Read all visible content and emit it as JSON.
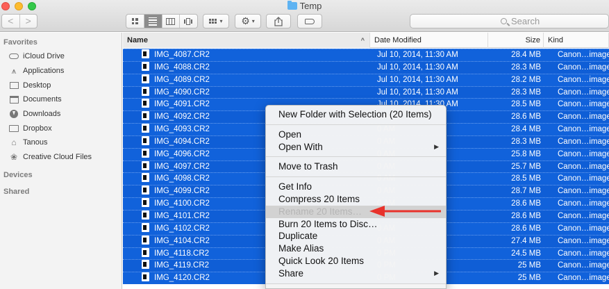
{
  "window": {
    "title": "Temp"
  },
  "toolbar": {
    "back_glyph": "<",
    "forward_glyph": ">",
    "view_modes": [
      "icon-view",
      "list-view",
      "column-view",
      "cover-flow-view"
    ],
    "active_view": "list-view",
    "arrange_icon": "arrange-icon",
    "action_icon": "gear-icon",
    "share_icon": "share-icon",
    "tag_icon": "tag-icon",
    "search_placeholder": "Search"
  },
  "sidebar": {
    "favorites_label": "Favorites",
    "items": [
      {
        "label": "iCloud Drive",
        "icon": "cloud-icon"
      },
      {
        "label": "Applications",
        "icon": "applications-icon"
      },
      {
        "label": "Desktop",
        "icon": "desktop-icon"
      },
      {
        "label": "Documents",
        "icon": "documents-icon"
      },
      {
        "label": "Downloads",
        "icon": "downloads-icon"
      },
      {
        "label": "Dropbox",
        "icon": "folder-icon"
      },
      {
        "label": "Tanous",
        "icon": "home-icon"
      },
      {
        "label": "Creative Cloud Files",
        "icon": "creative-cloud-icon"
      }
    ],
    "devices_label": "Devices",
    "shared_label": "Shared"
  },
  "list": {
    "columns": {
      "name": "Name",
      "date": "Date Modified",
      "size": "Size",
      "kind": "Kind"
    },
    "sort_indicator": "^",
    "rows": [
      {
        "name": "IMG_4087.CR2",
        "date": "Jul 10, 2014, 11:30 AM",
        "size": "28.4 MB",
        "kind": "Canon…image"
      },
      {
        "name": "IMG_4088.CR2",
        "date": "Jul 10, 2014, 11:30 AM",
        "size": "28.3 MB",
        "kind": "Canon…image"
      },
      {
        "name": "IMG_4089.CR2",
        "date": "Jul 10, 2014, 11:30 AM",
        "size": "28.2 MB",
        "kind": "Canon…image"
      },
      {
        "name": "IMG_4090.CR2",
        "date": "Jul 10, 2014, 11:30 AM",
        "size": "28.3 MB",
        "kind": "Canon…image"
      },
      {
        "name": "IMG_4091.CR2",
        "date": "Jul 10, 2014, 11:30 AM",
        "size": "28.5 MB",
        "kind": "Canon…image"
      },
      {
        "name": "IMG_4092.CR2",
        "date": "0 AM",
        "size": "28.6 MB",
        "kind": "Canon…image"
      },
      {
        "name": "IMG_4093.CR2",
        "date": "0 AM",
        "size": "28.4 MB",
        "kind": "Canon…image"
      },
      {
        "name": "IMG_4094.CR2",
        "date": "0 AM",
        "size": "28.3 MB",
        "kind": "Canon…image"
      },
      {
        "name": "IMG_4096.CR2",
        "date": "0 AM",
        "size": "25.8 MB",
        "kind": "Canon…image"
      },
      {
        "name": "IMG_4097.CR2",
        "date": "0 AM",
        "size": "25.7 MB",
        "kind": "Canon…image"
      },
      {
        "name": "IMG_4098.CR2",
        "date": "0 AM",
        "size": "28.5 MB",
        "kind": "Canon…image"
      },
      {
        "name": "IMG_4099.CR2",
        "date": "0 AM",
        "size": "28.7 MB",
        "kind": "Canon…image"
      },
      {
        "name": "IMG_4100.CR2",
        "date": "0 AM",
        "size": "28.6 MB",
        "kind": "Canon…image"
      },
      {
        "name": "IMG_4101.CR2",
        "date": "0 AM",
        "size": "28.6 MB",
        "kind": "Canon…image"
      },
      {
        "name": "IMG_4102.CR2",
        "date": "0 AM",
        "size": "28.6 MB",
        "kind": "Canon…image"
      },
      {
        "name": "IMG_4104.CR2",
        "date": "0 AM",
        "size": "27.4 MB",
        "kind": "Canon…image"
      },
      {
        "name": "IMG_4118.CR2",
        "date": "0 PM",
        "size": "24.5 MB",
        "kind": "Canon…image"
      },
      {
        "name": "IMG_4119.CR2",
        "date": "0 PM",
        "size": "25 MB",
        "kind": "Canon…image"
      },
      {
        "name": "IMG_4120.CR2",
        "date": "0 PM",
        "size": "25 MB",
        "kind": "Canon…image"
      }
    ]
  },
  "context_menu": {
    "new_folder": "New Folder with Selection (20 Items)",
    "open": "Open",
    "open_with": "Open With",
    "submenu_glyph": "▶",
    "move_to_trash": "Move to Trash",
    "get_info": "Get Info",
    "compress": "Compress 20 Items",
    "rename": "Rename 20 Items…",
    "burn": "Burn 20 Items to Disc…",
    "duplicate": "Duplicate",
    "make_alias": "Make Alias",
    "quick_look": "Quick Look 20 Items",
    "share": "Share"
  },
  "annotation": {
    "arrow_color": "#e8322b",
    "points_to": "rename"
  },
  "colors": {
    "selection": "#1162db",
    "sidebar_bg": "#f3f3f3"
  }
}
